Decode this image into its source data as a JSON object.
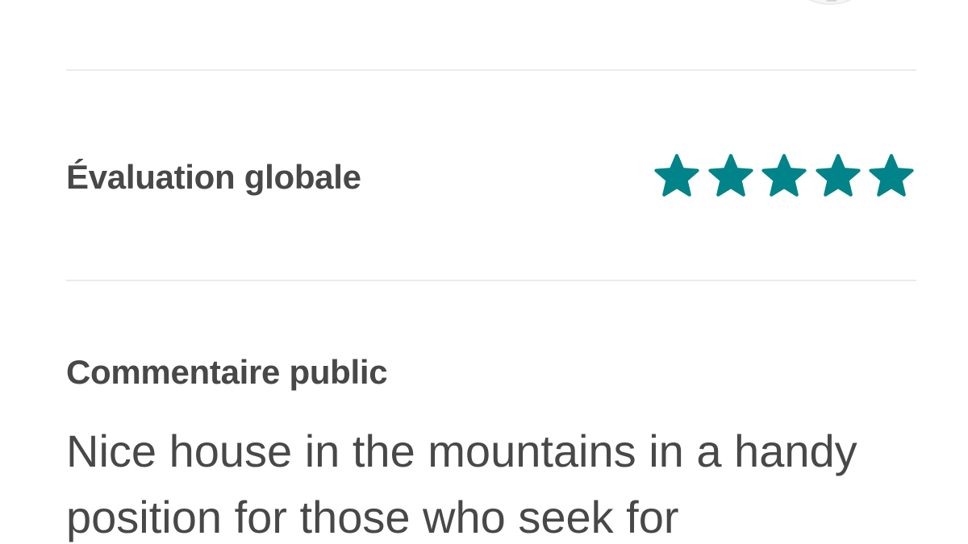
{
  "rating": {
    "label": "Évaluation globale",
    "stars_filled": 5,
    "stars_total": 5,
    "star_color": "#008489"
  },
  "comment": {
    "label": "Commentaire public",
    "text": "Nice house in the mountains in a handy position for those who seek for"
  },
  "colors": {
    "text": "#484848",
    "divider": "#ebebeb",
    "accent": "#008489"
  }
}
